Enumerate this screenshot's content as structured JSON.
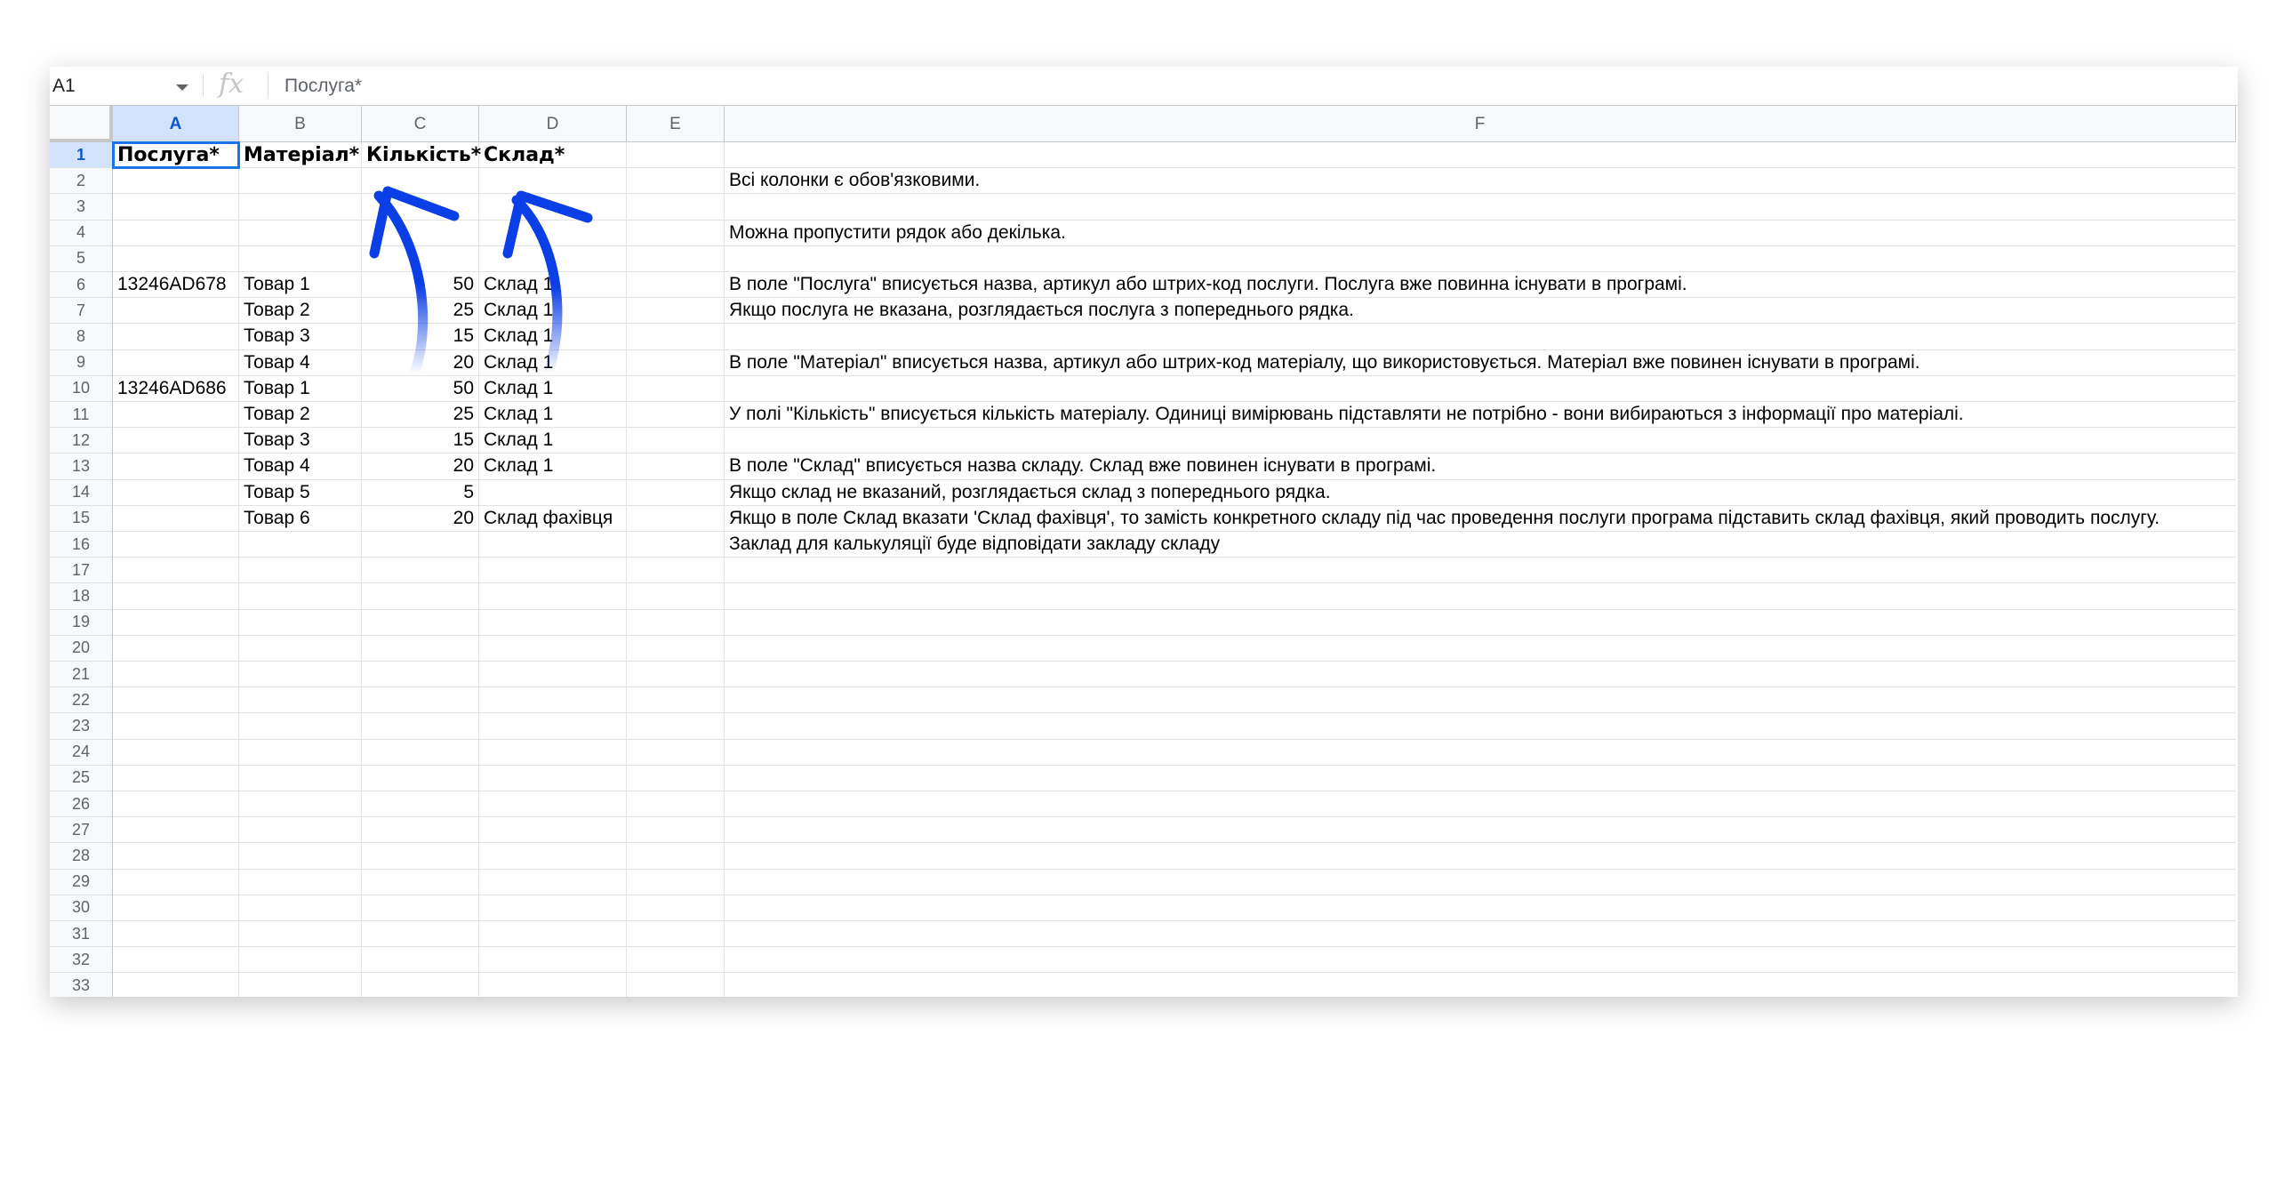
{
  "formula_bar": {
    "name_box": "A1",
    "fx_label": "fx",
    "content": "Послуга*"
  },
  "columns": [
    "A",
    "B",
    "C",
    "D",
    "E",
    "F"
  ],
  "rows": [
    {
      "n": "1",
      "A": "Послуга*",
      "B": "Матеріал*",
      "C": "Кількість*",
      "D": "Склад*",
      "E": "",
      "F": ""
    },
    {
      "n": "2",
      "A": "",
      "B": "",
      "C": "",
      "D": "",
      "E": "",
      "F": "Всі колонки є обов'язковими."
    },
    {
      "n": "3",
      "A": "",
      "B": "",
      "C": "",
      "D": "",
      "E": "",
      "F": ""
    },
    {
      "n": "4",
      "A": "",
      "B": "",
      "C": "",
      "D": "",
      "E": "",
      "F": "Можна пропустити рядок або декілька."
    },
    {
      "n": "5",
      "A": "",
      "B": "",
      "C": "",
      "D": "",
      "E": "",
      "F": ""
    },
    {
      "n": "6",
      "A": "13246AD678",
      "B": "Товар 1",
      "C": "50",
      "D": "Склад 1",
      "E": "",
      "F": "В поле \"Послуга\" вписується назва, артикул або штрих-код послуги. Послуга вже повинна існувати в програмі."
    },
    {
      "n": "7",
      "A": "",
      "B": "Товар 2",
      "C": "25",
      "D": "Склад 1",
      "E": "",
      "F": "Якщо послуга не вказана, розглядається послуга з попереднього рядка."
    },
    {
      "n": "8",
      "A": "",
      "B": "Товар 3",
      "C": "15",
      "D": "Склад 1",
      "E": "",
      "F": ""
    },
    {
      "n": "9",
      "A": "",
      "B": "Товар 4",
      "C": "20",
      "D": "Склад 1",
      "E": "",
      "F": "В поле \"Матеріал\" вписується назва, артикул або штрих-код матеріалу, що використовується. Матеріал вже повинен існувати в програмі."
    },
    {
      "n": "10",
      "A": "13246AD686",
      "B": "Товар 1",
      "C": "50",
      "D": "Склад 1",
      "E": "",
      "F": ""
    },
    {
      "n": "11",
      "A": "",
      "B": "Товар 2",
      "C": "25",
      "D": "Склад 1",
      "E": "",
      "F": "У полі \"Кількість\" вписується кількість матеріалу. Одиниці вимірювань підставляти не потрібно - вони вибираються з інформації про матеріалі."
    },
    {
      "n": "12",
      "A": "",
      "B": "Товар 3",
      "C": "15",
      "D": "Склад 1",
      "E": "",
      "F": ""
    },
    {
      "n": "13",
      "A": "",
      "B": "Товар 4",
      "C": "20",
      "D": "Склад 1",
      "E": "",
      "F": "В поле \"Склад\" вписується назва складу. Склад вже повинен існувати в програмі."
    },
    {
      "n": "14",
      "A": "",
      "B": "Товар 5",
      "C": "5",
      "D": "",
      "E": "",
      "F": "Якщо склад не вказаний, розглядається склад з попереднього рядка."
    },
    {
      "n": "15",
      "A": "",
      "B": "Товар 6",
      "C": "20",
      "D": "Склад фахівця",
      "E": "",
      "F": "Якщо в поле Склад вказати 'Склад фахівця', то замість конкретного складу під час проведення послуги програма підставить склад фахівця, який проводить послугу."
    },
    {
      "n": "16",
      "A": "",
      "B": "",
      "C": "",
      "D": "",
      "E": "",
      "F": "Заклад для калькуляції буде відповідати закладу складу"
    },
    {
      "n": "17",
      "A": "",
      "B": "",
      "C": "",
      "D": "",
      "E": "",
      "F": ""
    },
    {
      "n": "18",
      "A": "",
      "B": "",
      "C": "",
      "D": "",
      "E": "",
      "F": ""
    },
    {
      "n": "19",
      "A": "",
      "B": "",
      "C": "",
      "D": "",
      "E": "",
      "F": ""
    },
    {
      "n": "20",
      "A": "",
      "B": "",
      "C": "",
      "D": "",
      "E": "",
      "F": ""
    },
    {
      "n": "21",
      "A": "",
      "B": "",
      "C": "",
      "D": "",
      "E": "",
      "F": ""
    },
    {
      "n": "22",
      "A": "",
      "B": "",
      "C": "",
      "D": "",
      "E": "",
      "F": ""
    },
    {
      "n": "23",
      "A": "",
      "B": "",
      "C": "",
      "D": "",
      "E": "",
      "F": ""
    },
    {
      "n": "24",
      "A": "",
      "B": "",
      "C": "",
      "D": "",
      "E": "",
      "F": ""
    },
    {
      "n": "25",
      "A": "",
      "B": "",
      "C": "",
      "D": "",
      "E": "",
      "F": ""
    },
    {
      "n": "26",
      "A": "",
      "B": "",
      "C": "",
      "D": "",
      "E": "",
      "F": ""
    },
    {
      "n": "27",
      "A": "",
      "B": "",
      "C": "",
      "D": "",
      "E": "",
      "F": ""
    },
    {
      "n": "28",
      "A": "",
      "B": "",
      "C": "",
      "D": "",
      "E": "",
      "F": ""
    },
    {
      "n": "29",
      "A": "",
      "B": "",
      "C": "",
      "D": "",
      "E": "",
      "F": ""
    },
    {
      "n": "30",
      "A": "",
      "B": "",
      "C": "",
      "D": "",
      "E": "",
      "F": ""
    },
    {
      "n": "31",
      "A": "",
      "B": "",
      "C": "",
      "D": "",
      "E": "",
      "F": ""
    },
    {
      "n": "32",
      "A": "",
      "B": "",
      "C": "",
      "D": "",
      "E": "",
      "F": ""
    },
    {
      "n": "33",
      "A": "",
      "B": "",
      "C": "",
      "D": "",
      "E": "",
      "F": ""
    }
  ],
  "selection": {
    "cell": "A1",
    "column": "A",
    "row": "1"
  },
  "colors": {
    "accent": "#1a73e8",
    "arrow": "#0a3ee6",
    "header_bg": "#f8f9fa",
    "selected_header_bg": "#d3e3fd"
  },
  "annotations": [
    {
      "name": "arrow-to-kilkist",
      "points_to": "C1"
    },
    {
      "name": "arrow-to-sklad",
      "points_to": "D1"
    }
  ]
}
